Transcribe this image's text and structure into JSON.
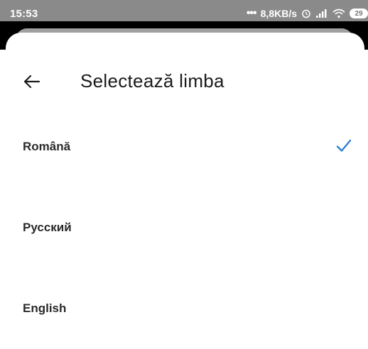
{
  "status_bar": {
    "time": "15:53",
    "net_speed": "8,8KB/s",
    "battery": "29"
  },
  "header": {
    "back_icon": "arrow-left-icon",
    "title": "Selectează limba"
  },
  "languages": [
    {
      "label": "Română",
      "selected": true
    },
    {
      "label": "Русский",
      "selected": false
    },
    {
      "label": "English",
      "selected": false
    }
  ],
  "colors": {
    "accent": "#2f7fd8",
    "status_bar_bg": "#8a8a8a",
    "text": "#2a2a2a"
  }
}
